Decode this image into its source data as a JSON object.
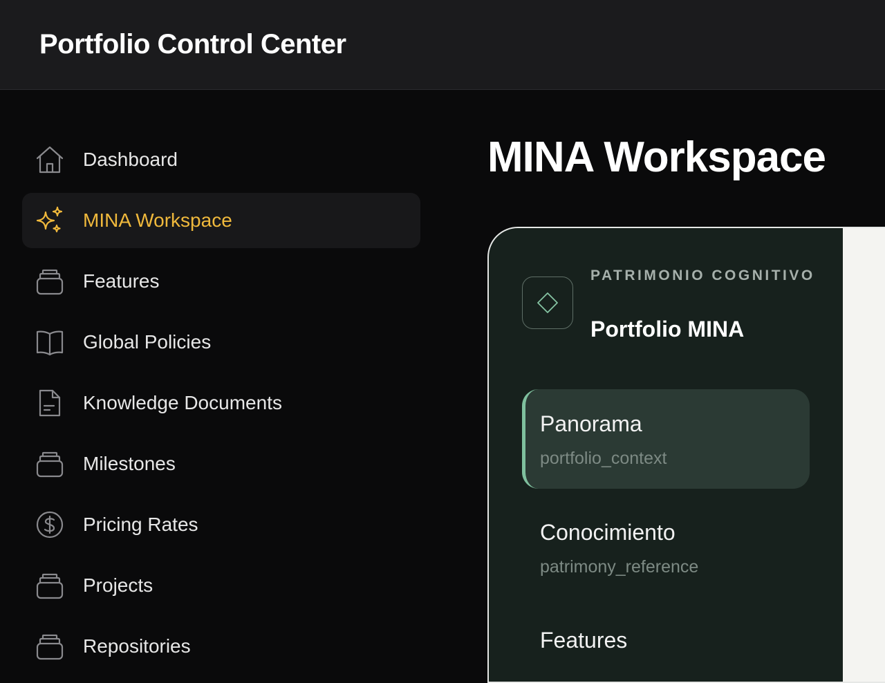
{
  "header": {
    "app_title": "Portfolio Control Center"
  },
  "sidebar": {
    "items": [
      {
        "label": "Dashboard",
        "icon": "home-icon",
        "active": false
      },
      {
        "label": "MINA Workspace",
        "icon": "sparkles-icon",
        "active": true
      },
      {
        "label": "Features",
        "icon": "stack-icon",
        "active": false
      },
      {
        "label": "Global Policies",
        "icon": "book-icon",
        "active": false
      },
      {
        "label": "Knowledge Documents",
        "icon": "document-icon",
        "active": false
      },
      {
        "label": "Milestones",
        "icon": "stack-icon",
        "active": false
      },
      {
        "label": "Pricing Rates",
        "icon": "dollar-circle-icon",
        "active": false
      },
      {
        "label": "Projects",
        "icon": "stack-icon",
        "active": false
      },
      {
        "label": "Repositories",
        "icon": "stack-icon",
        "active": false
      }
    ]
  },
  "main": {
    "page_title": "MINA Workspace",
    "panel": {
      "brand_icon": "diamond-icon",
      "eyebrow": "PATRIMONIO COGNITIVO",
      "portfolio_name": "Portfolio MINA",
      "items": [
        {
          "title": "Panorama",
          "subtitle": "portfolio_context",
          "active": true
        },
        {
          "title": "Conocimiento",
          "subtitle": "patrimony_reference",
          "active": false
        },
        {
          "title": "Features",
          "subtitle": "",
          "active": false
        }
      ]
    }
  },
  "colors": {
    "accent": "#f0b93c",
    "panel_bg": "#17211d",
    "panel_active": "#2b3a34",
    "panel_indicator": "#7fc09e"
  }
}
